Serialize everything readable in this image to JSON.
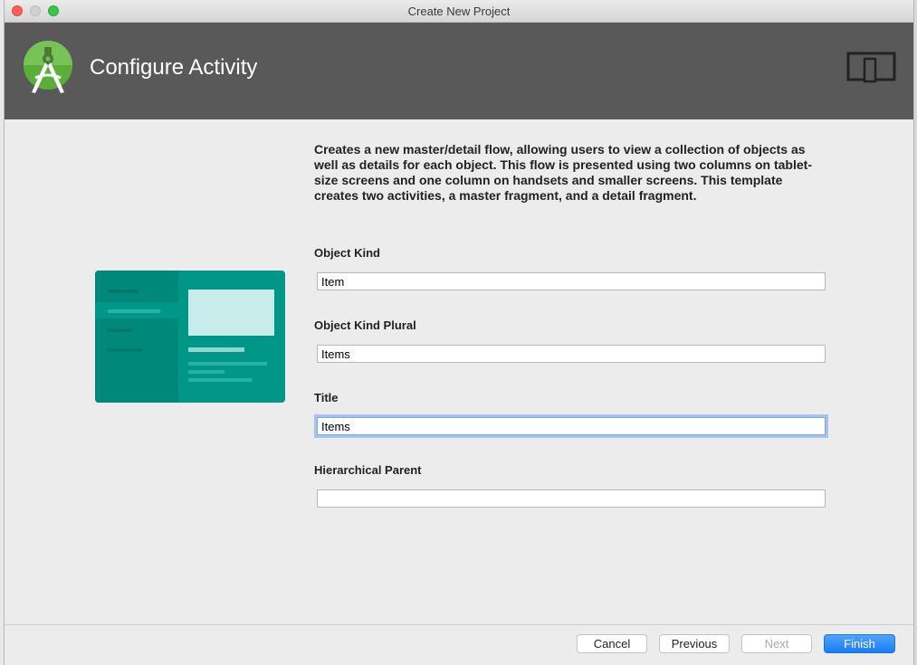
{
  "window": {
    "title": "Create New Project"
  },
  "header": {
    "title": "Configure Activity",
    "logo_icon": "android-studio-logo",
    "device_icon": "tablet-phone-icon",
    "background": "#595959"
  },
  "description": "Creates a new master/detail flow, allowing users to view a collection of objects as well as details for each object. This flow is presented using two columns on tablet-size screens and one column on handsets and smaller screens. This template creates two activities, a master fragment, and a detail fragment.",
  "form": {
    "object_kind": {
      "label": "Object Kind",
      "value": "Item"
    },
    "object_kind_plural": {
      "label": "Object Kind Plural",
      "value": "Items"
    },
    "title": {
      "label": "Title",
      "value": "Items"
    },
    "hierarchical_parent": {
      "label": "Hierarchical Parent",
      "value": ""
    }
  },
  "buttons": {
    "cancel": "Cancel",
    "previous": "Previous",
    "next": "Next",
    "finish": "Finish"
  },
  "colors": {
    "accent": "#1b7cf2",
    "template_preview": "#009688"
  }
}
